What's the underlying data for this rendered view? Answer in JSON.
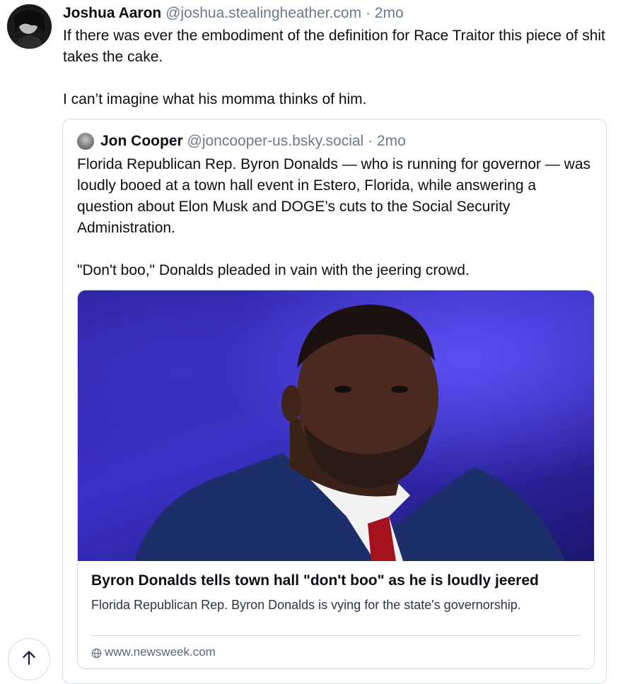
{
  "post": {
    "author_name": "Joshua Aaron",
    "author_handle": "@joshua.stealingheather.com",
    "time": "· 2mo",
    "text_line1": "If there was ever the embodiment of the definition for Race Traitor this piece of shit takes the cake.",
    "text_line2": "I can’t imagine what his momma thinks of him."
  },
  "quote": {
    "author_name": "Jon Cooper",
    "author_handle": "@joncooper-us.bsky.social",
    "time": "· 2mo",
    "text_para1": "Florida Republican Rep. Byron Donalds — who is running for governor — was loudly booed at a town hall event in Estero, Florida, while answering a question about Elon Musk and DOGE’s cuts to the Social Security Administration.",
    "text_para2": "\"Don't boo,\" Donalds pleaded in vain with the jeering crowd."
  },
  "link_card": {
    "title": "Byron Donalds tells town hall \"don't boo\" as he is loudly jeered",
    "description": "Florida Republican Rep. Byron Donalds is vying for the state's governorship.",
    "domain": "www.newsweek.com",
    "domain_icon": "globe-icon"
  },
  "icons": {
    "scroll_top": "arrow-up-icon"
  },
  "colors": {
    "muted_text": "#6b7a8a",
    "border": "#d4dbe2",
    "image_background": "#3b30c8"
  }
}
